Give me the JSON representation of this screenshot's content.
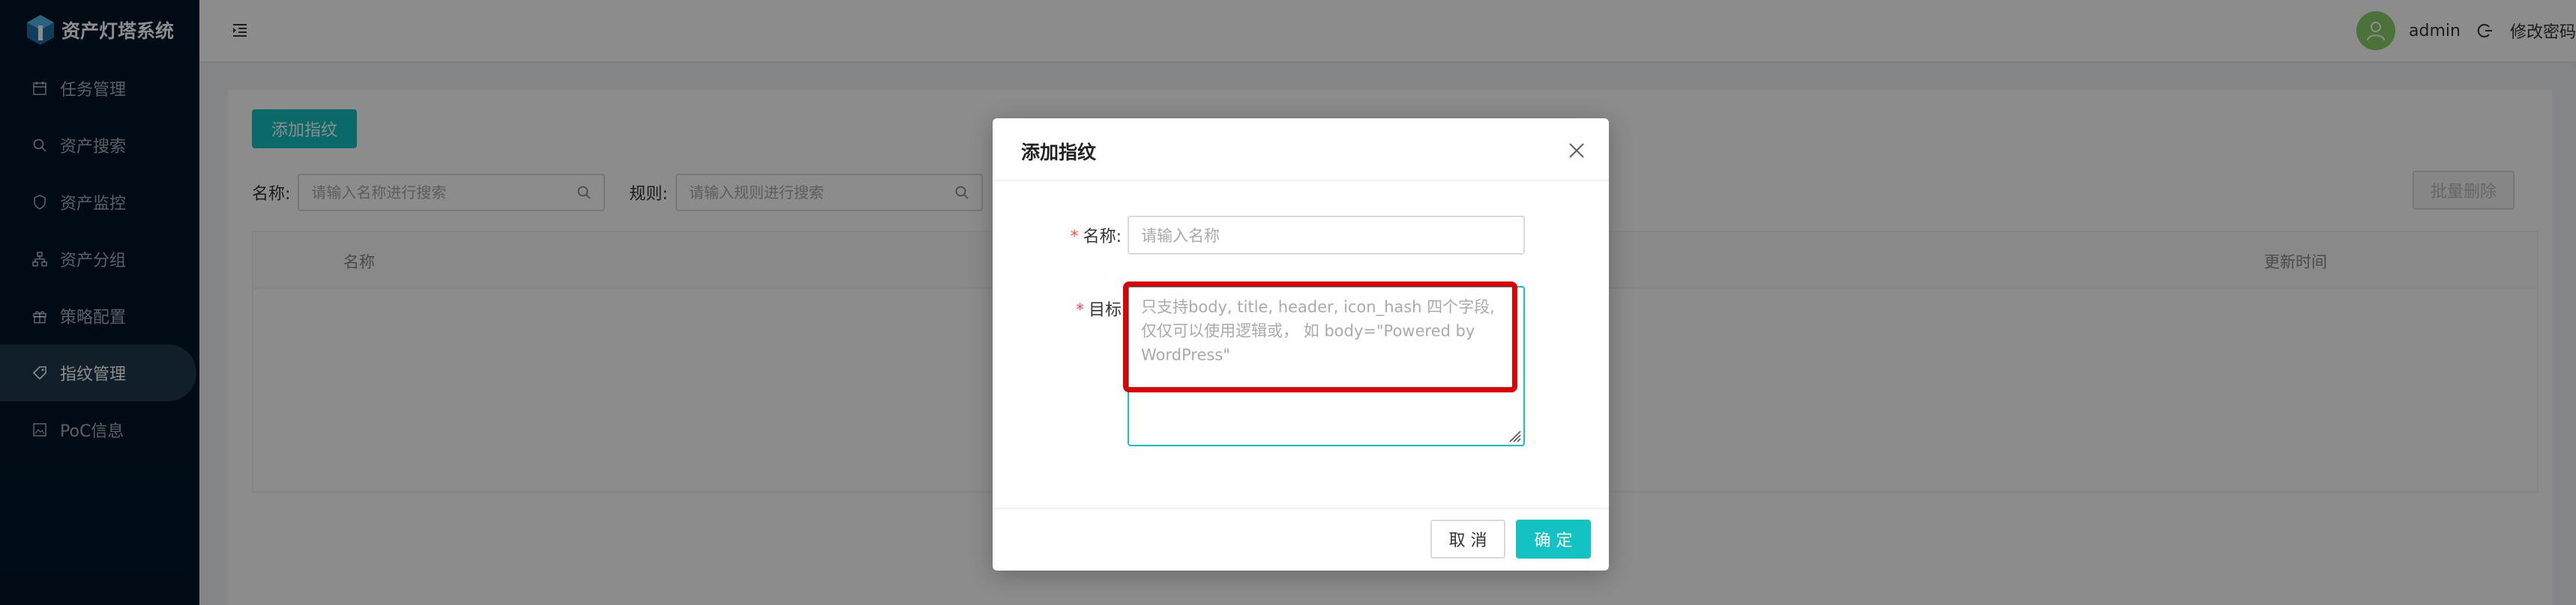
{
  "app": {
    "title": "资产灯塔系统"
  },
  "sidebar": {
    "items": [
      {
        "label": "任务管理",
        "icon": "calendar-icon"
      },
      {
        "label": "资产搜索",
        "icon": "search-icon"
      },
      {
        "label": "资产监控",
        "icon": "shield-icon"
      },
      {
        "label": "资产分组",
        "icon": "cluster-icon"
      },
      {
        "label": "策略配置",
        "icon": "gift-icon"
      },
      {
        "label": "指纹管理",
        "icon": "tag-icon",
        "active": true
      },
      {
        "label": "PoC信息",
        "icon": "file-image-icon"
      }
    ]
  },
  "header": {
    "username": "admin",
    "change_password": "修改密码"
  },
  "toolbar": {
    "add_button": "添加指纹",
    "name_label": "名称:",
    "name_placeholder": "请输入名称进行搜索",
    "rule_label": "规则:",
    "rule_placeholder": "请输入规则进行搜索",
    "batch_delete": "批量删除"
  },
  "table": {
    "columns": [
      "名称",
      "更新时间"
    ]
  },
  "modal": {
    "title": "添加指纹",
    "name_label": "名称",
    "name_placeholder": "请输入名称",
    "target_label": "目标",
    "target_placeholder": "只支持body, title, header, icon_hash 四个字段, 仅仅可以使用逻辑或， 如 body=\"Powered by WordPress\"",
    "cancel": "取 消",
    "ok": "确 定"
  },
  "colors": {
    "primary": "#13c2c2",
    "sidebar_bg": "#001529",
    "highlight": "#e00000",
    "avatar": "#87d068"
  }
}
